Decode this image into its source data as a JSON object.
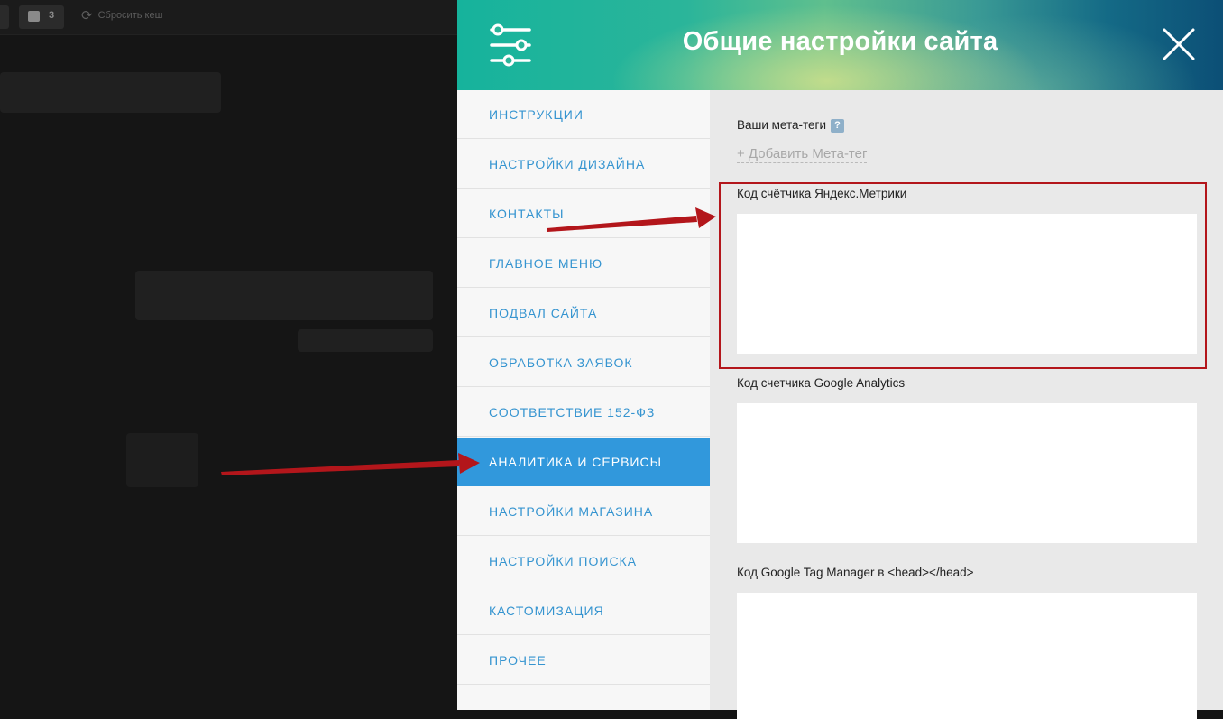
{
  "background": {
    "notification_count": "3",
    "reset_cache_label": "Сбросить кеш"
  },
  "modal": {
    "title": "Общие настройки сайта",
    "icons": {
      "settings": "sliders-icon",
      "close": "close-x-icon"
    }
  },
  "sidebar": {
    "items": [
      {
        "label": "ИНСТРУКЦИИ"
      },
      {
        "label": "НАСТРОЙКИ ДИЗАЙНА"
      },
      {
        "label": "КОНТАКТЫ"
      },
      {
        "label": "ГЛАВНОЕ МЕНЮ"
      },
      {
        "label": "ПОДВАЛ САЙТА"
      },
      {
        "label": "ОБРАБОТКА ЗАЯВОК"
      },
      {
        "label": "СООТВЕТСТВИЕ 152-ФЗ"
      },
      {
        "label": "АНАЛИТИКА И СЕРВИСЫ",
        "active": true
      },
      {
        "label": "НАСТРОЙКИ МАГАЗИНА"
      },
      {
        "label": "НАСТРОЙКИ ПОИСКА"
      },
      {
        "label": "КАСТОМИЗАЦИЯ"
      },
      {
        "label": "ПРОЧЕЕ"
      }
    ]
  },
  "content": {
    "meta_tags_label": "Ваши мета-теги",
    "help_badge": "?",
    "add_meta_tag_link": "+ Добавить Мета-тег",
    "yandex_metrika_label": "Код счётчика Яндекс.Метрики",
    "yandex_metrika_value": "",
    "google_analytics_label": "Код счетчика Google Analytics",
    "google_analytics_value": "",
    "gtm_head_label": "Код Google Tag Manager в <head></head>",
    "gtm_head_value": ""
  },
  "annotations": {
    "arrow_color": "#b3161b",
    "highlight_color": "#b3161b"
  },
  "colors": {
    "accent": "#3198dc",
    "nav_text": "#3594d0"
  }
}
